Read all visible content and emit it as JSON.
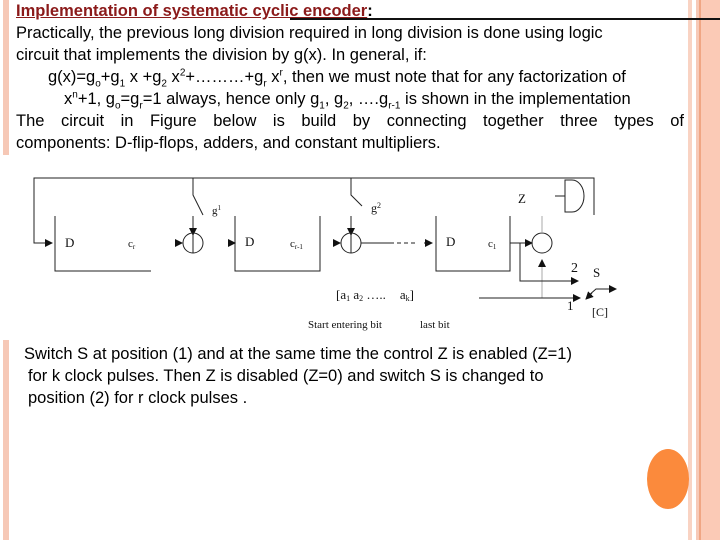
{
  "slide": {
    "title": "Implementation of systematic cyclic encoder",
    "title_suffix": ":",
    "paragraph1": {
      "line1": "Practically, the previous long division required in long division is done using logic",
      "line2": "circuit that implements the division by g(x). In general, if:",
      "formula": {
        "prefix": "g(x)=g",
        "sub0": "o",
        "p1": "+g",
        "sub1": "1",
        "p2": " x +g",
        "sub2": "2",
        "p3": " x",
        "sup2": "2",
        "p4": "+………+g",
        "subr": "r",
        "p5": " x",
        "supr": "r",
        "p6": ", then we must note that for any factorization of"
      },
      "line4": {
        "p1": "x",
        "supn": "n",
        "p2": "+1, g",
        "sub0": "o",
        "p3": "=g",
        "subr": "r",
        "p4": "=1 always, hence only g",
        "sub1": "1",
        "p5": ", g",
        "sub2": "2",
        "p6": ", ….g",
        "subr1": "r-1",
        "p7": " is shown in the implementation"
      },
      "line5": "The circuit in Figure below is build by connecting together three types of",
      "line6": "components: D-flip-flops, adders, and constant multipliers."
    },
    "diagram": {
      "flipflop_label": "D",
      "register_labels": [
        "c",
        "c",
        "c"
      ],
      "register_subs": [
        "r",
        "r-1",
        "1"
      ],
      "multiplier_labels": [
        {
          "base": "g",
          "sup": "1"
        },
        {
          "base": "g",
          "sup": "2"
        }
      ],
      "control_label": "Z",
      "switch_label": "S",
      "switch_positions": [
        "2",
        "1"
      ],
      "output_label": "[C]",
      "input_sequence": {
        "open": "[a",
        "s1": "1",
        "mid": " a",
        "s2": "2",
        "dots": " …..",
        "last": "a",
        "sk": "k",
        "close": "]"
      },
      "caption_start": "Start entering bit",
      "caption_last": "last bit"
    },
    "bottom_text": {
      "line1": "Switch S at position (1) and at the same time the control Z  is enabled (Z=1)",
      "line2": "for k clock pulses. Then Z is disabled (Z=0) and switch S is changed to",
      "line3": "position (2) for r clock pulses  ."
    },
    "colors": {
      "title": "#8b1a1a",
      "accent_bar": "#f6c8b6",
      "orange_dot": "#fb8a3c"
    }
  }
}
